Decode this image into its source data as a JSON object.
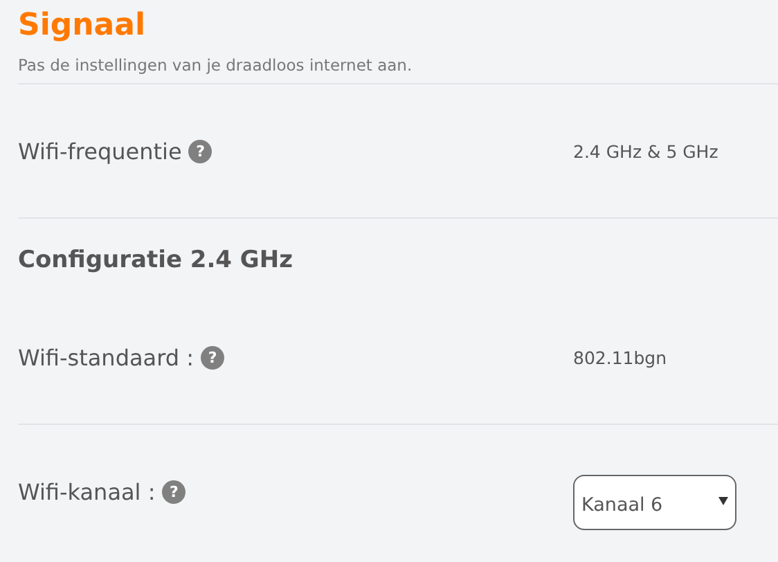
{
  "header": {
    "title": "Signaal",
    "subtitle": "Pas de instellingen van je draadloos internet aan."
  },
  "sections": [
    {
      "rows": [
        {
          "kind": "text",
          "label": "Wifi-frequentie",
          "help": "?",
          "value": "2.4 GHz & 5 GHz"
        }
      ]
    },
    {
      "heading": "Configuratie 2.4 GHz",
      "rows": [
        {
          "kind": "text",
          "label": "Wifi-standaard :",
          "help": "?",
          "value": "802.11bgn"
        }
      ]
    },
    {
      "rows": [
        {
          "kind": "select",
          "label": "Wifi-kanaal :",
          "help": "?",
          "value": "Kanaal 6"
        }
      ]
    }
  ]
}
